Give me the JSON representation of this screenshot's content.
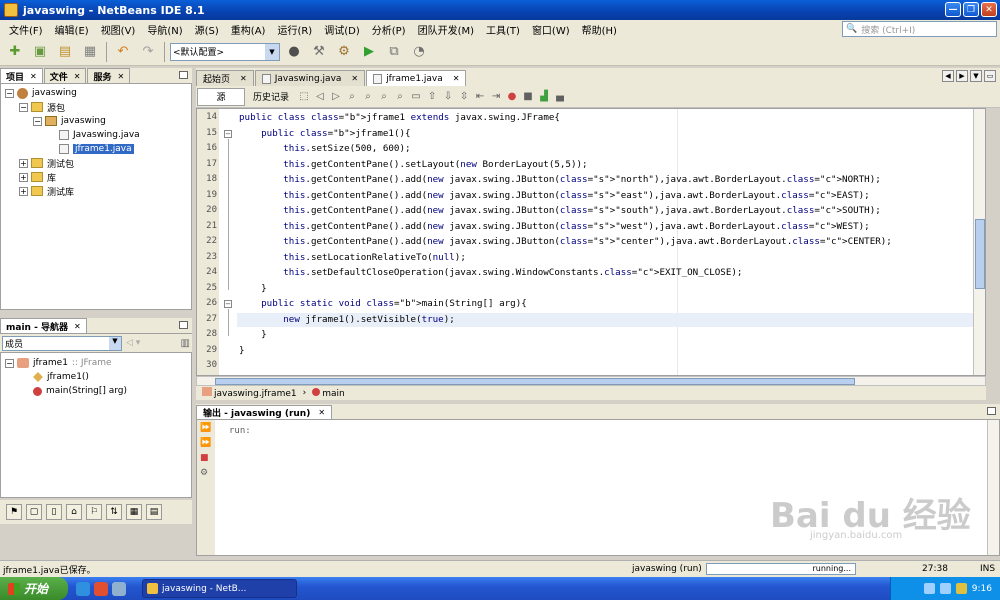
{
  "window": {
    "title": "javaswing - NetBeans IDE 8.1",
    "minimize_glyph": "—",
    "maximize_glyph": "❐",
    "close_glyph": "✕"
  },
  "menu": {
    "items": [
      "文件(F)",
      "编辑(E)",
      "视图(V)",
      "导航(N)",
      "源(S)",
      "重构(A)",
      "运行(R)",
      "调试(D)",
      "分析(P)",
      "团队开发(M)",
      "工具(T)",
      "窗口(W)",
      "帮助(H)"
    ],
    "search_placeholder": "搜索 (Ctrl+I)"
  },
  "toolbar": {
    "config_value": "<默认配置>"
  },
  "project_panel": {
    "tabs": [
      "项目",
      "文件",
      "服务"
    ],
    "tree": [
      {
        "label": "javaswing",
        "level": 0,
        "icon": "project-icon",
        "expander": "−"
      },
      {
        "label": "源包",
        "level": 1,
        "icon": "folder-icon",
        "expander": "−"
      },
      {
        "label": "javaswing",
        "level": 2,
        "icon": "package-icon",
        "expander": "−"
      },
      {
        "label": "Javaswing.java",
        "level": 3,
        "icon": "java-file-icon",
        "expander": ""
      },
      {
        "label": "jframe1.java",
        "level": 3,
        "icon": "java-file-icon",
        "expander": "",
        "selected": true
      },
      {
        "label": "测试包",
        "level": 1,
        "icon": "folder-icon",
        "expander": "+"
      },
      {
        "label": "库",
        "level": 1,
        "icon": "folder-icon",
        "expander": "+"
      },
      {
        "label": "测试库",
        "level": 1,
        "icon": "folder-icon",
        "expander": "+"
      }
    ]
  },
  "navigator": {
    "title": "main - 导航器",
    "filter_value": "成员",
    "class_label": "jframe1",
    "class_super": ":: JFrame",
    "members": [
      "jframe1()",
      "main(String[] arg)"
    ]
  },
  "editor": {
    "tabs": [
      "起始页",
      "Javaswing.java",
      "jframe1.java"
    ],
    "active_tab": 2,
    "source_button": "源",
    "history_button": "历史记录",
    "current_line": 27,
    "lines": [
      {
        "n": "14",
        "fold": "",
        "html": "public class <b>jframe1</b> extends javax.swing.JFrame{"
      },
      {
        "n": "15",
        "fold": "−",
        "html": "    public <b>jframe1</b>(){"
      },
      {
        "n": "16",
        "fold": "",
        "html": "        this.setSize(500, 600);"
      },
      {
        "n": "17",
        "fold": "",
        "html": "        this.getContentPane().setLayout(new BorderLayout(5,5));"
      },
      {
        "n": "18",
        "fold": "",
        "html": "        this.getContentPane().add(new javax.swing.JButton(<s>\"north\"</s>),java.awt.BorderLayout.<c>NORTH</c>);"
      },
      {
        "n": "19",
        "fold": "",
        "html": "        this.getContentPane().add(new javax.swing.JButton(<s>\"east\"</s>),java.awt.BorderLayout.<c>EAST</c>);"
      },
      {
        "n": "20",
        "fold": "",
        "html": "        this.getContentPane().add(new javax.swing.JButton(<s>\"south\"</s>),java.awt.BorderLayout.<c>SOUTH</c>);"
      },
      {
        "n": "21",
        "fold": "",
        "html": "        this.getContentPane().add(new javax.swing.JButton(<s>\"west\"</s>),java.awt.BorderLayout.<c>WEST</c>);"
      },
      {
        "n": "22",
        "fold": "",
        "html": "        this.getContentPane().add(new javax.swing.JButton(<s>\"center\"</s>),java.awt.BorderLayout.<c>CENTER</c>);"
      },
      {
        "n": "23",
        "fold": "",
        "html": "        this.setLocationRelativeTo(null);"
      },
      {
        "n": "24",
        "fold": "",
        "html": "        this.setDefaultCloseOperation(javax.swing.WindowConstants.<c>EXIT_ON_CLOSE</c>);"
      },
      {
        "n": "25",
        "fold": "",
        "html": "    }"
      },
      {
        "n": "26",
        "fold": "−",
        "html": "    public static void <b>main</b>(String[] arg){"
      },
      {
        "n": "27",
        "fold": "",
        "html": "        new jframe1().setVisible(true);"
      },
      {
        "n": "28",
        "fold": "",
        "html": "    }"
      },
      {
        "n": "29",
        "fold": "",
        "html": "}"
      },
      {
        "n": "30",
        "fold": "",
        "html": ""
      }
    ],
    "breadcrumb": [
      "javaswing.jframe1",
      "main"
    ]
  },
  "output": {
    "tab_label": "输出 - javaswing (run)",
    "text": "run:"
  },
  "status": {
    "message": "jframe1.java已保存。",
    "run_label": "javaswing (run)",
    "progress_text": "running...",
    "position": "27:38",
    "mode": "INS"
  },
  "taskbar": {
    "start_label": "开始",
    "task_label": "javaswing - NetB...",
    "clock": "9:16"
  },
  "watermark": {
    "text": "Bai du 经验",
    "sub": "jingyan.baidu.com"
  },
  "colors": {
    "titlebar": "#0842b0",
    "selection": "#316ac5",
    "current_line": "#e9eff8",
    "string": "#ce7b00",
    "constant": "#009900"
  }
}
